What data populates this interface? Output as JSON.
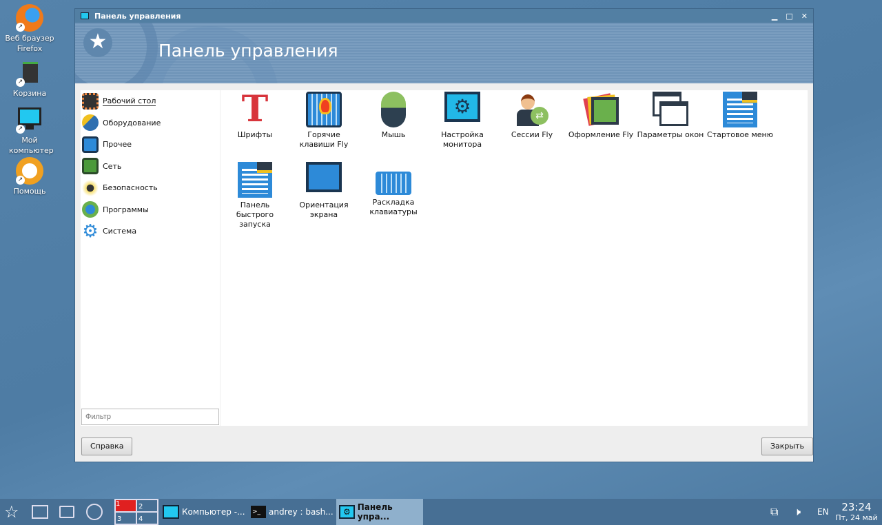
{
  "desktop": {
    "icons": [
      {
        "label": "Веб браузер Firefox"
      },
      {
        "label": "Корзина"
      },
      {
        "label": "Мой компьютер"
      },
      {
        "label": "Помощь"
      }
    ]
  },
  "window": {
    "title": "Панель управления",
    "banner_title": "Панель управления",
    "categories": [
      {
        "label": "Рабочий стол",
        "color": "#333"
      },
      {
        "label": "Оборудование",
        "color": "#2f6fb0"
      },
      {
        "label": "Прочее",
        "color": "#1e5f9f"
      },
      {
        "label": "Сеть",
        "color": "#4b9a3a"
      },
      {
        "label": "Безопасность",
        "color": "#e0b020"
      },
      {
        "label": "Программы",
        "color": "#6ab04c"
      },
      {
        "label": "Система",
        "color": "#2d8ad8"
      }
    ],
    "filter_placeholder": "Фильтр",
    "items": [
      {
        "label": "Шрифты"
      },
      {
        "label": "Горячие клавиши Fly"
      },
      {
        "label": "Мышь"
      },
      {
        "label": "Настройка монитора"
      },
      {
        "label": "Сессии Fly"
      },
      {
        "label": "Оформление Fly"
      },
      {
        "label": "Параметры окон"
      },
      {
        "label": "Стартовое меню"
      },
      {
        "label": "Панель быстрого запуска"
      },
      {
        "label": "Ориентация экрана"
      },
      {
        "label": "Раскладка клавиатуры"
      }
    ],
    "help_button": "Справка",
    "close_button": "Закрыть"
  },
  "taskbar": {
    "pager": [
      "1",
      "2",
      "3",
      "4"
    ],
    "tasks": [
      {
        "label": "Компьютер -..."
      },
      {
        "label": "andrey : bash..."
      },
      {
        "label": "Панель упра..."
      }
    ],
    "lang": "EN",
    "time": "23:24",
    "date": "Пт, 24 май"
  }
}
